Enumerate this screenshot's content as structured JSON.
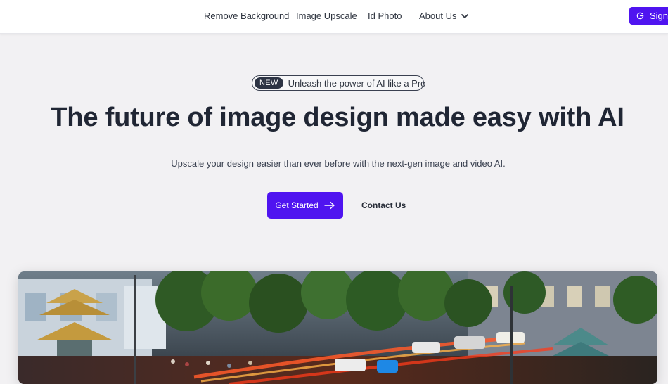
{
  "nav": {
    "links": [
      "Remove Background",
      "Image Upscale",
      "Id Photo",
      "About Us"
    ],
    "signin_label": "Sign"
  },
  "hero": {
    "badge_tag": "NEW",
    "badge_text": "Unleash the power of AI like a Pro",
    "title": "The future of image design made easy with AI",
    "subtitle": "Upscale your design easier than ever before with the next-gen image and video AI.",
    "primary_cta": "Get Started",
    "secondary_cta": "Contact Us"
  },
  "colors": {
    "accent": "#4f14f0",
    "page_background": "#f2f1f3",
    "heading": "#202634"
  },
  "icons": [
    "chevron-down-icon",
    "google-icon",
    "arrow-right-icon"
  ]
}
